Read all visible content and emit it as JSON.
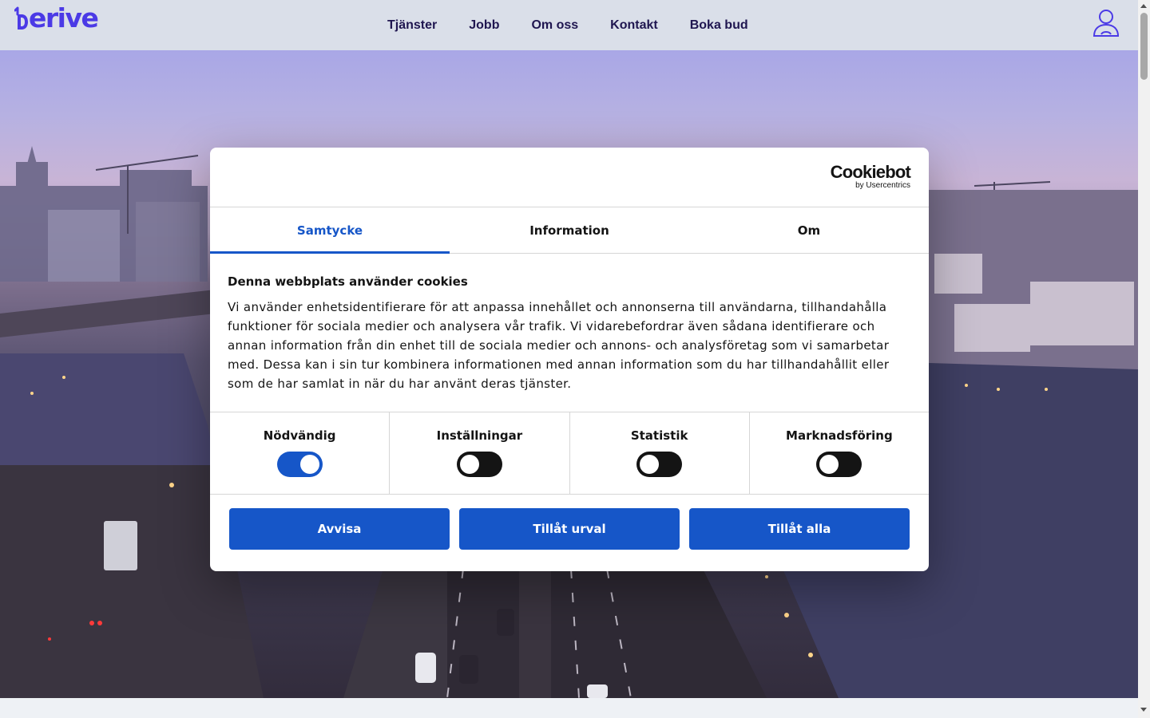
{
  "header": {
    "logo_text": "erive",
    "nav": [
      "Tjänster",
      "Jobb",
      "Om oss",
      "Kontakt",
      "Boka bud"
    ]
  },
  "colors": {
    "brand": "#4b3ae6",
    "header_bg": "#dadfe9",
    "nav_text": "#1f1650",
    "dialog_accent": "#1656c8",
    "switch_off": "#141414"
  },
  "icons": {
    "logo_mark": "derive-d-logo-icon",
    "account": "user-account-icon"
  },
  "hero": {
    "image": "aerial-view-of-stockholm-at-dusk"
  },
  "cookie_dialog": {
    "brand": {
      "name": "Cookiebot",
      "sub": "by Usercentrics"
    },
    "tabs": [
      {
        "label": "Samtycke",
        "active": true
      },
      {
        "label": "Information",
        "active": false
      },
      {
        "label": "Om",
        "active": false
      }
    ],
    "title": "Denna webbplats använder cookies",
    "text": "Vi använder enhetsidentifierare för att anpassa innehållet och annonserna till användarna, tillhandahålla funktioner för sociala medier och analysera vår trafik. Vi vidarebefordrar även sådana identifierare och annan information från din enhet till de sociala medier och annons- och analysföretag som vi samarbetar med. Dessa kan i sin tur kombinera informationen med annan information som du har tillhandahållit eller som de har samlat in när du har använt deras tjänster.",
    "categories": [
      {
        "label": "Nödvändig",
        "enabled": true
      },
      {
        "label": "Inställningar",
        "enabled": false
      },
      {
        "label": "Statistik",
        "enabled": false
      },
      {
        "label": "Marknadsföring",
        "enabled": false
      }
    ],
    "buttons": {
      "reject": "Avvisa",
      "allow_selection": "Tillåt urval",
      "allow_all": "Tillåt alla"
    }
  }
}
